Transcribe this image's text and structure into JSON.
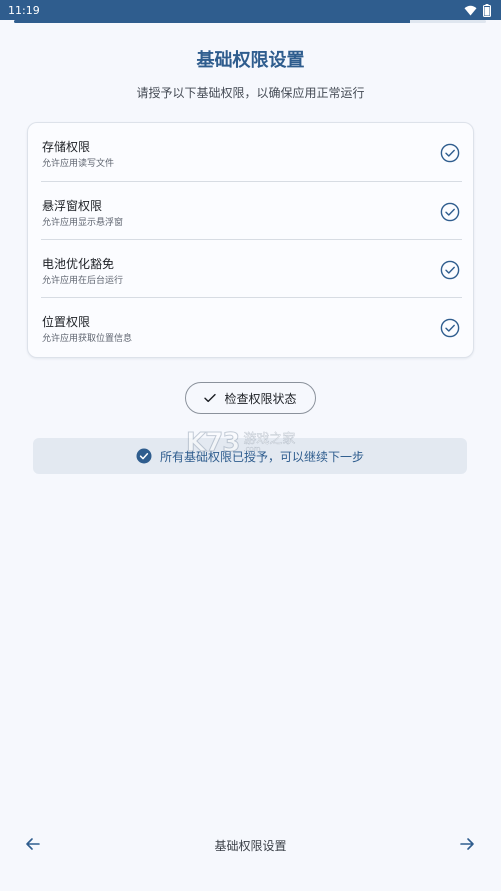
{
  "status_bar": {
    "time": "11:19"
  },
  "progress": {
    "fraction": 0.84
  },
  "header": {
    "title": "基础权限设置",
    "subtitle": "请授予以下基础权限，以确保应用正常运行"
  },
  "permissions": [
    {
      "name": "存储权限",
      "description": "允许应用读写文件",
      "granted": true
    },
    {
      "name": "悬浮窗权限",
      "description": "允许应用显示悬浮窗",
      "granted": true
    },
    {
      "name": "电池优化豁免",
      "description": "允许应用在后台运行",
      "granted": true
    },
    {
      "name": "位置权限",
      "description": "允许应用获取位置信息",
      "granted": true
    }
  ],
  "check_button": {
    "label": "检查权限状态"
  },
  "banner": {
    "text": "所有基础权限已授予，可以继续下一步"
  },
  "bottom_nav": {
    "title": "基础权限设置"
  },
  "colors": {
    "primary": "#2f5d8e",
    "background": "#f6f8fd",
    "banner_bg": "#e3e9f1"
  },
  "icons": {
    "wifi": "wifi-icon",
    "battery": "battery-icon",
    "granted": "check-circle-icon",
    "back": "arrow-left-icon",
    "forward": "arrow-right-icon"
  }
}
